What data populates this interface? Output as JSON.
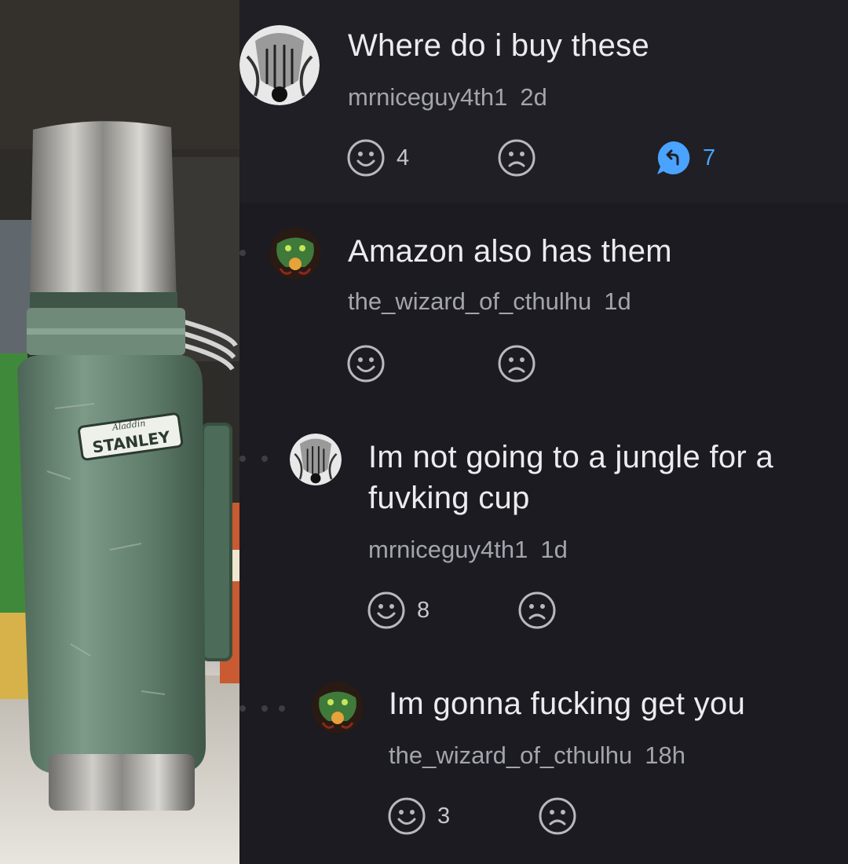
{
  "photo": {
    "brand": "STANLEY",
    "sub_brand": "Aladdin"
  },
  "comments": [
    {
      "text": "Where do i buy these",
      "author": "mrniceguy4th1",
      "age": "2d",
      "likes": "4",
      "replies": "7"
    },
    {
      "text": "Amazon also has them",
      "author": "the_wizard_of_cthulhu",
      "age": "1d",
      "likes": "",
      "replies": ""
    },
    {
      "text": "Im not going to a jungle for a\nfuvking cup",
      "author": "mrniceguy4th1",
      "age": "1d",
      "likes": "8",
      "replies": ""
    },
    {
      "text": "Im gonna fucking get you",
      "author": "the_wizard_of_cthulhu",
      "age": "18h",
      "likes": "3",
      "replies": ""
    }
  ],
  "icons": {
    "like": "smiley-icon",
    "dislike": "frown-icon",
    "reply": "reply-bubble-icon"
  },
  "colors": {
    "background": "#1b1b21",
    "reply_accent": "#4aa3ff",
    "thermos_green": "#5a7a66"
  }
}
